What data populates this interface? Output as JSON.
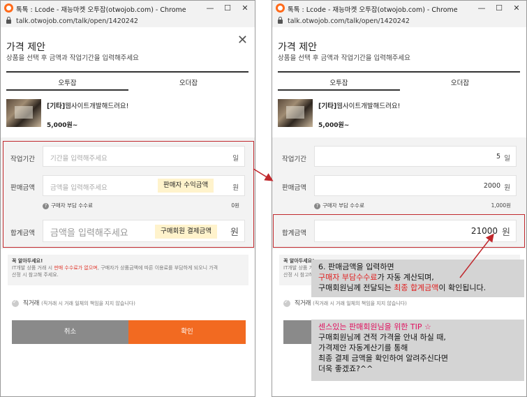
{
  "window": {
    "title": "톡톡 : Lcode - 재능마켓 오투잡(otwojob.com) - Chrome",
    "url": "talk.otwojob.com/talk/open/1420242",
    "controls": {
      "minimize": "—",
      "maximize": "☐",
      "close": "✕"
    }
  },
  "modal": {
    "title": "가격 제안",
    "subtitle": "상품을 선택 후 금액과 작업기간을 입력해주세요",
    "close_icon": "✕"
  },
  "tabs": [
    {
      "label": "오투잡",
      "active": true
    },
    {
      "label": "오더잡",
      "active": false
    }
  ],
  "product": {
    "category": "[기타]",
    "title": "웹사이트개발해드려요!",
    "price": "5,000원~"
  },
  "form": {
    "period_label": "작업기간",
    "period_placeholder": "기간을 입력해주세요",
    "period_unit": "일",
    "sale_label": "판매금액",
    "sale_placeholder": "금액을 입력해주세요",
    "sale_unit": "원",
    "sale_tag": "판매자 수익금액",
    "fee_label": "구매자 부담 수수료",
    "total_label": "합계금액",
    "total_placeholder": "금액을 입력해주세요",
    "total_unit": "원",
    "total_tag": "구매회원 결제금액"
  },
  "form_left": {
    "fee_value": "0원"
  },
  "form_right": {
    "period_value": "5",
    "sale_value": "2000",
    "fee_value": "1,000원",
    "total_value": "21000"
  },
  "notice": {
    "title": "꼭 알아두세요!",
    "line1_a": "IT개발 상품 거래 시 ",
    "line1_red": "판매 수수료가 없으며",
    "line1_b": ", 구매자가 상품금액에 따른 이용료를 부담하게 되오니 가격",
    "line2": "산정 시 참고해 주세요."
  },
  "direct": {
    "label": "직거래",
    "note": "(직거래 시 거래 일체의 책임을 지지 않습니다)"
  },
  "buttons": {
    "cancel": "취소",
    "confirm": "확인"
  },
  "callout1": {
    "line1": "6. 판매금액을 입력하면",
    "line2_red": "구매자 부담수수료",
    "line2_rest": "가 자동 계산되며,",
    "line3_a": "구매회원님께 전달되는 ",
    "line3_red": "최종 합계금액",
    "line3_b": "이 확인됩니다."
  },
  "callout2": {
    "title_pink": "센스있는 판매회원님을 위한 TIP ☆",
    "line1": "구매회원님께 견적 가격을 안내 하실 때,",
    "line2": "가격제안 자동계산기를 통해",
    "line3": "최종 결제 금액을 확인하여 알려주신다면",
    "line4": "더욱 좋겠죠?^^"
  },
  "colors": {
    "accent": "#f26a21",
    "highlight_border": "#c0282d",
    "tag_bg": "#fff3cc"
  }
}
